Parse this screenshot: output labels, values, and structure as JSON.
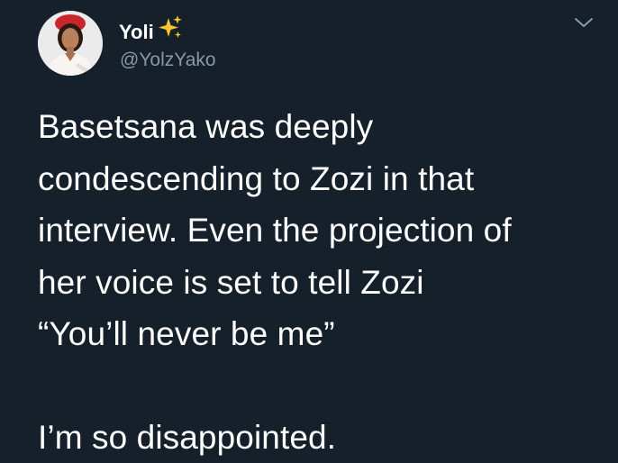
{
  "tweet": {
    "display_name": "Yoli",
    "name_emoji": "sparkles-icon",
    "handle": "@YolzYako",
    "text": "Basetsana was deeply\ncondescending to Zozi in that\ninterview. Even the projection of\nher voice is set to tell Zozi\n“You’ll never be me”\n\nI’m so disappointed."
  },
  "icons": {
    "menu": "chevron-down-icon",
    "avatar": "avatar"
  },
  "colors": {
    "background": "#15202b",
    "text": "#ffffff",
    "secondary_text": "#8899a6",
    "sparkle": "#f7c62f"
  }
}
